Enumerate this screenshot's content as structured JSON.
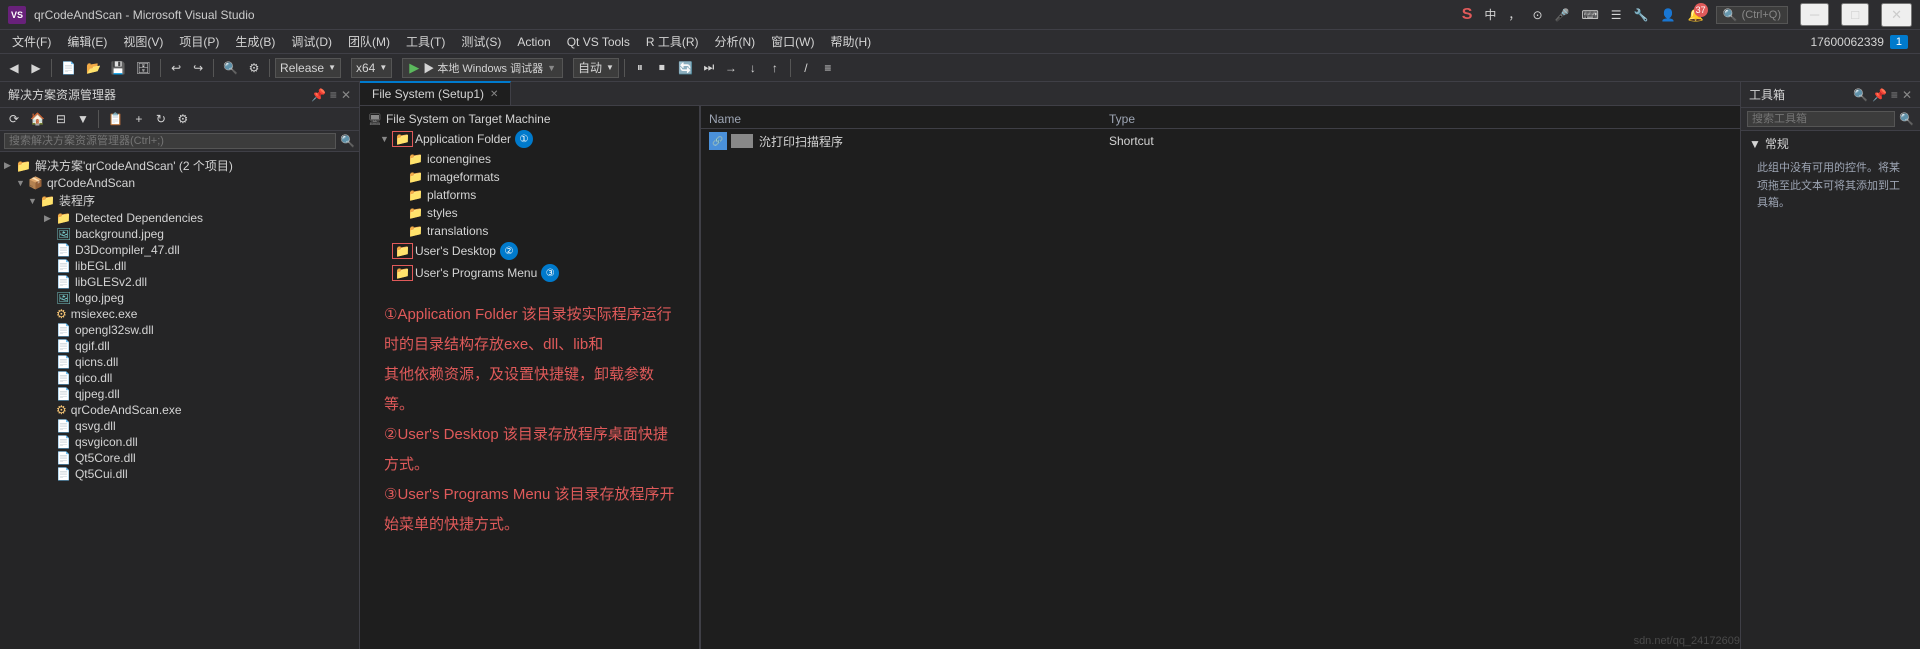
{
  "titleBar": {
    "logo": "VS",
    "title": "qrCodeAndScan - Microsoft Visual Studio",
    "minimize": "─",
    "maximize": "□",
    "close": "✕"
  },
  "menuBar": {
    "items": [
      "文件(F)",
      "编辑(E)",
      "视图(V)",
      "项目(P)",
      "生成(B)",
      "调试(D)",
      "团队(M)",
      "工具(T)",
      "测试(S)",
      "Action",
      "Qt VS Tools",
      "R 工具(R)",
      "分析(N)",
      "窗口(W)",
      "帮助(H)"
    ]
  },
  "toolbar": {
    "configuration": "Release",
    "platform": "x64",
    "runLabel": "▶ 本地 Windows 调试器",
    "automation": "自动",
    "phoneNumber": "17600062339"
  },
  "tabs": {
    "fileSystem": "File System (Setup1)",
    "active": true
  },
  "leftPanel": {
    "title": "解决方案资源管理器",
    "searchPlaceholder": "搜索解决方案资源管理器(Ctrl+;)",
    "tree": {
      "solutionLabel": "解决方案'qrCodeAndScan' (2 个项目)",
      "projectLabel": "qrCodeAndScan",
      "installerLabel": "装程序",
      "items": [
        "Detected Dependencies",
        "background.jpeg",
        "D3Dcompiler_47.dll",
        "libEGL.dll",
        "libGLESv2.dll",
        "logo.jpeg",
        "msiexec.exe",
        "opengl32sw.dll",
        "qgif.dll",
        "qicns.dll",
        "qico.dll",
        "qjpeg.dll",
        "qrCodeAndScan.exe",
        "qsvg.dll",
        "qsvgicon.dll",
        "Qt5Core.dll",
        "Qt5Cui.dll"
      ]
    }
  },
  "fileSystem": {
    "header": "File System on Target Machine",
    "folders": [
      {
        "name": "Application Folder",
        "badge": "①",
        "highlighted": true,
        "indent": 1
      },
      {
        "name": "iconengines",
        "indent": 2
      },
      {
        "name": "imageformats",
        "indent": 2
      },
      {
        "name": "platforms",
        "indent": 2
      },
      {
        "name": "styles",
        "indent": 2
      },
      {
        "name": "translations",
        "indent": 2
      },
      {
        "name": "User's Desktop",
        "badge": "②",
        "highlighted": true,
        "indent": 1
      },
      {
        "name": "User's Programs Menu",
        "badge": "③",
        "highlighted": true,
        "indent": 1
      }
    ],
    "tableColumns": {
      "name": "Name",
      "type": "Type"
    },
    "tableRows": [
      {
        "name": "沇打印扫描程序",
        "type": "Shortcut"
      }
    ]
  },
  "annotations": {
    "line1": "①Application Folder 该目录按实际程序运行时的目录结构存放exe、dll、lib和",
    "line2": "其他依赖资源，及设置快捷键，卸载参数等。",
    "line3": "②User's Desktop 该目录存放程序桌面快捷方式。",
    "line4": "③User's Programs Menu 该目录存放程序开始菜单的快捷方式。"
  },
  "rightPanel": {
    "title": "工具箱",
    "searchPlaceholder": "搜索工具箱",
    "section": "常规",
    "emptyText": "此组中没有可用的控件。将某项拖至此文本可将其添加到工具箱。"
  },
  "watermark": "sdn.net/qq_24172609"
}
